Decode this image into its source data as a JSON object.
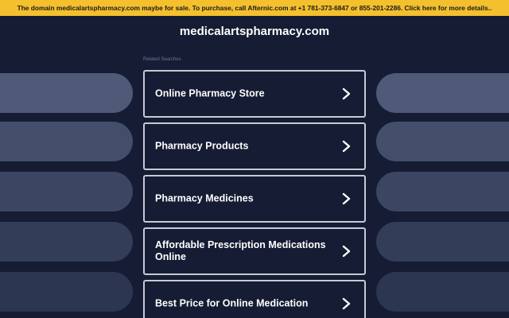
{
  "banner": {
    "text": "The domain medicalartspharmacy.com maybe for sale. To purchase, call Afternic.com at +1 781-373-6847 or 855-201-2286. Click here for more details.."
  },
  "header": {
    "domain": "medicalartspharmacy.com"
  },
  "related": {
    "label": "Related Searches",
    "links": [
      {
        "label": "Online Pharmacy Store",
        "icon": "chevron-right-icon"
      },
      {
        "label": "Pharmacy Products",
        "icon": "chevron-right-icon"
      },
      {
        "label": "Pharmacy Medicines",
        "icon": "chevron-right-icon"
      },
      {
        "label": "Affordable Prescription Medications Online",
        "icon": "chevron-right-icon"
      },
      {
        "label": "Best Price for Online Medication",
        "icon": "chevron-right-icon"
      }
    ]
  },
  "colors": {
    "background": "#151c33",
    "banner": "#f4c02e",
    "card_border": "#c5cad6",
    "side_pill_gradient": [
      "#4e5a78",
      "#434e6b",
      "#3b4662",
      "#333d58",
      "#2d3650"
    ]
  }
}
